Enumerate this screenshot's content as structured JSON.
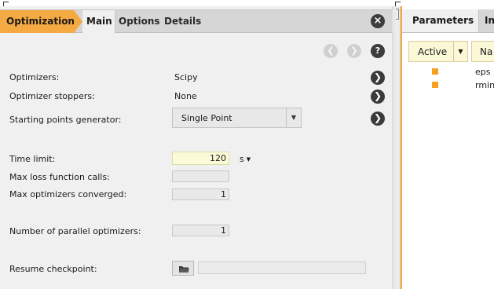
{
  "breadcrumb": {
    "active": "Optimization"
  },
  "tabs": {
    "main": "Main",
    "options": "Options",
    "details": "Details"
  },
  "icons": {
    "close": "×",
    "back": "❮",
    "forward": "❯",
    "help": "?",
    "go": "❯",
    "dropdown": "▼",
    "folder": "folder-icon"
  },
  "form": {
    "optimizers": {
      "label": "Optimizers:",
      "value": "Scipy"
    },
    "stoppers": {
      "label": "Optimizer stoppers:",
      "value": "None"
    },
    "generator": {
      "label": "Starting points generator:",
      "value": "Single Point"
    },
    "time_limit": {
      "label": "Time limit:",
      "value": "120",
      "unit": "s"
    },
    "max_loss_calls": {
      "label": "Max loss function calls:",
      "value": ""
    },
    "max_converged": {
      "label": "Max optimizers converged:",
      "value": "1"
    },
    "parallel": {
      "label": "Number of parallel optimizers:",
      "value": "1"
    },
    "resume": {
      "label": "Resume checkpoint:",
      "value": ""
    }
  },
  "right_panel": {
    "tabs": {
      "parameters": "Parameters",
      "next": "In"
    },
    "filters": {
      "active": "Active",
      "name": "Na"
    },
    "params": [
      "eps",
      "rmin"
    ],
    "accent": "#f5a942"
  }
}
